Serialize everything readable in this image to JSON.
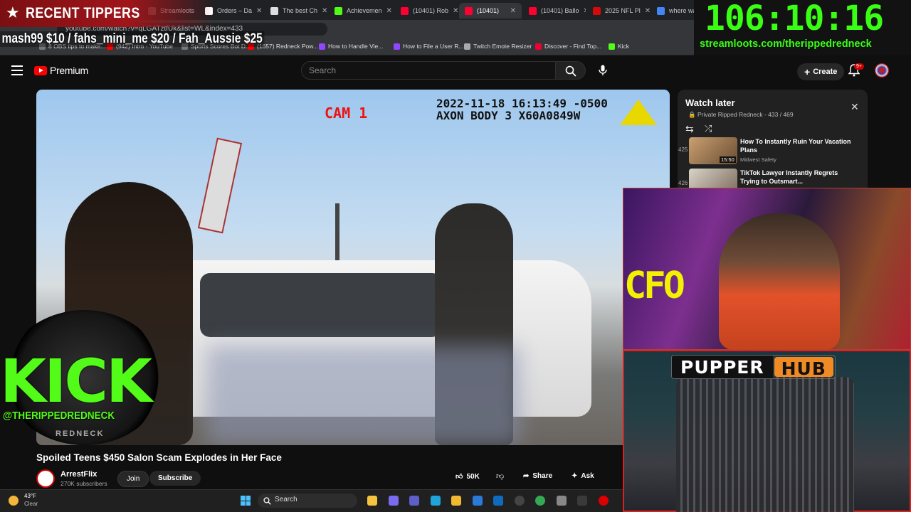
{
  "browser": {
    "tabs": [
      {
        "label": "Streamloots",
        "color": "#6b6b6b"
      },
      {
        "label": "Orders – Da",
        "color": "#ffffff"
      },
      {
        "label": "The best Ch",
        "color": "#dddddd"
      },
      {
        "label": "Achievemen",
        "color": "#53fc18"
      },
      {
        "label": "(10401) Rob",
        "color": "#ff0033"
      },
      {
        "label": "(10401)",
        "color": "#ff0033"
      },
      {
        "label": "(10401) Ballo",
        "color": "#ff0033"
      },
      {
        "label": "2025 NFL Pl",
        "color": "#d50a0a"
      },
      {
        "label": "where was",
        "color": "#4285f4"
      }
    ],
    "url": "youtube.com/watch?v=qLGATztfUk&list=WL&index=433",
    "bookmarks": [
      {
        "label": "8 OBS tips to make...",
        "color": "#777"
      },
      {
        "label": "(942) Intro - YouTube",
        "color": "#ff0000"
      },
      {
        "label": "Sports Scores Bot D...",
        "color": "#777"
      },
      {
        "label": "(1657) Redneck Pow...",
        "color": "#ff0000"
      },
      {
        "label": "How to Handle Vie...",
        "color": "#9146ff"
      },
      {
        "label": "How to File a User R...",
        "color": "#9146ff"
      },
      {
        "label": "Twitch Emote Resizer",
        "color": "#aaa"
      },
      {
        "label": "Discover - Find Top...",
        "color": "#e03"
      },
      {
        "label": "Kick",
        "color": "#53fc18"
      }
    ]
  },
  "overlay": {
    "tippers_title": "RECENT TIPPERS",
    "tippers_ticker": "mash99 $10 / fahs_mini_me $20 / Fah_Aussie $25",
    "timer": "106:10:16",
    "streamloots_url": "streamloots.com/therippedredneck",
    "kick_word": "KICK",
    "kick_handle": "@THERIPPEDREDNECK",
    "kick_sub": "REDNECK",
    "webcam_text": "CFO",
    "pupper_word": "PUPPER",
    "hub_word": "HUB"
  },
  "youtube": {
    "logo_text": "Premium",
    "search_placeholder": "Search",
    "create_label": "Create",
    "notification_count": "9+",
    "video": {
      "cam_label": "CAM 1",
      "timestamp_line1": "2022-11-18 16:13:49 -0500",
      "timestamp_line2": "AXON BODY 3 X60A0849W",
      "title": "Spoiled Teens $450 Salon Scam Explodes in Her Face"
    },
    "channel": {
      "name": "ArrestFlix",
      "subscribers": "270K subscribers",
      "join_label": "Join",
      "subscribe_label": "Subscribe"
    },
    "actions": {
      "likes": "50K",
      "share_label": "Share",
      "ask_label": "Ask"
    },
    "playlist": {
      "title": "Watch later",
      "subtitle": "Private Ripped Redneck - 433 / 469",
      "items": [
        {
          "index": "425",
          "title": "How To Instantly Ruin Your Vacation Plans",
          "channel": "Midwest Safety",
          "duration": "15:50"
        },
        {
          "index": "426",
          "title": "TikTok Lawyer Instantly Regrets Trying to Outsmart...",
          "channel": "",
          "duration": ""
        }
      ]
    }
  },
  "taskbar": {
    "temperature": "43°F",
    "condition": "Clear",
    "search_label": "Search",
    "apps": [
      {
        "name": "file-explorer",
        "color": "#f6c33f"
      },
      {
        "name": "copilot",
        "color": "#7a6cf0"
      },
      {
        "name": "teams",
        "color": "#5b5fc7"
      },
      {
        "name": "edge",
        "color": "#1fa3d8"
      },
      {
        "name": "folder",
        "color": "#f1b92f"
      },
      {
        "name": "store",
        "color": "#2a7ad8"
      },
      {
        "name": "outlook",
        "color": "#0f6cbd"
      },
      {
        "name": "obs",
        "color": "#444"
      },
      {
        "name": "chrome",
        "color": "#34a853"
      },
      {
        "name": "app-gray",
        "color": "#888"
      },
      {
        "name": "terminal",
        "color": "#3a3a3a"
      },
      {
        "name": "espn",
        "color": "#d00"
      }
    ]
  }
}
